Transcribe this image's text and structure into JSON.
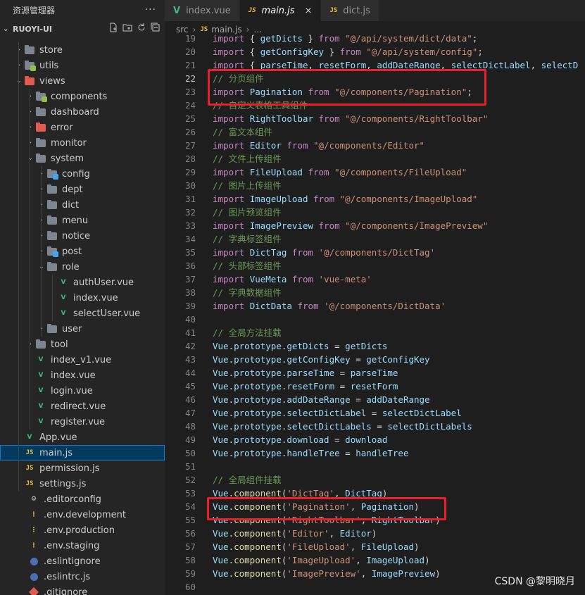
{
  "explorer": {
    "title": "资源管理器",
    "more": "···",
    "root_label": "RUOYI-UI",
    "items": [
      {
        "label": "store",
        "depth": 1,
        "kind": "folder",
        "chev": "›"
      },
      {
        "label": "utils",
        "depth": 1,
        "kind": "folder-green",
        "chev": "›"
      },
      {
        "label": "views",
        "depth": 1,
        "kind": "folder-red",
        "chev": "⌄"
      },
      {
        "label": "components",
        "depth": 2,
        "kind": "folder-green",
        "chev": "›"
      },
      {
        "label": "dashboard",
        "depth": 2,
        "kind": "folder",
        "chev": "›"
      },
      {
        "label": "error",
        "depth": 2,
        "kind": "folder-red",
        "chev": "›"
      },
      {
        "label": "monitor",
        "depth": 2,
        "kind": "folder",
        "chev": "›"
      },
      {
        "label": "system",
        "depth": 2,
        "kind": "folder",
        "chev": "⌄"
      },
      {
        "label": "config",
        "depth": 3,
        "kind": "folder-blue",
        "chev": "›"
      },
      {
        "label": "dept",
        "depth": 3,
        "kind": "folder",
        "chev": "›"
      },
      {
        "label": "dict",
        "depth": 3,
        "kind": "folder",
        "chev": "›"
      },
      {
        "label": "menu",
        "depth": 3,
        "kind": "folder",
        "chev": "›"
      },
      {
        "label": "notice",
        "depth": 3,
        "kind": "folder",
        "chev": "›"
      },
      {
        "label": "post",
        "depth": 3,
        "kind": "folder-blue",
        "chev": "›"
      },
      {
        "label": "role",
        "depth": 3,
        "kind": "folder",
        "chev": "⌄"
      },
      {
        "label": "authUser.vue",
        "depth": 4,
        "kind": "vue",
        "chev": ""
      },
      {
        "label": "index.vue",
        "depth": 4,
        "kind": "vue",
        "chev": ""
      },
      {
        "label": "selectUser.vue",
        "depth": 4,
        "kind": "vue",
        "chev": ""
      },
      {
        "label": "user",
        "depth": 3,
        "kind": "folder",
        "chev": "›"
      },
      {
        "label": "tool",
        "depth": 2,
        "kind": "folder",
        "chev": "›"
      },
      {
        "label": "index_v1.vue",
        "depth": 2,
        "kind": "vue",
        "chev": ""
      },
      {
        "label": "index.vue",
        "depth": 2,
        "kind": "vue",
        "chev": ""
      },
      {
        "label": "login.vue",
        "depth": 2,
        "kind": "vue",
        "chev": ""
      },
      {
        "label": "redirect.vue",
        "depth": 2,
        "kind": "vue",
        "chev": ""
      },
      {
        "label": "register.vue",
        "depth": 2,
        "kind": "vue",
        "chev": ""
      },
      {
        "label": "App.vue",
        "depth": 1,
        "kind": "vue",
        "chev": ""
      },
      {
        "label": "main.js",
        "depth": 1,
        "kind": "js",
        "chev": "",
        "selected": true
      },
      {
        "label": "permission.js",
        "depth": 1,
        "kind": "js",
        "chev": ""
      },
      {
        "label": "settings.js",
        "depth": 1,
        "kind": "js",
        "chev": ""
      },
      {
        "label": ".editorconfig",
        "depth": 0,
        "kind": "gear",
        "chev": ""
      },
      {
        "label": ".env.development",
        "depth": 0,
        "kind": "env",
        "chev": ""
      },
      {
        "label": ".env.production",
        "depth": 0,
        "kind": "env",
        "chev": ""
      },
      {
        "label": ".env.staging",
        "depth": 0,
        "kind": "env",
        "chev": ""
      },
      {
        "label": ".eslintignore",
        "depth": 0,
        "kind": "dot",
        "chev": ""
      },
      {
        "label": ".eslintrc.js",
        "depth": 0,
        "kind": "dot",
        "chev": ""
      },
      {
        "label": ".gitignore",
        "depth": 0,
        "kind": "git",
        "chev": ""
      }
    ]
  },
  "tabs": [
    {
      "label": "index.vue",
      "icon": "vue",
      "active": false
    },
    {
      "label": "main.js",
      "icon": "js",
      "active": true,
      "close": "×"
    },
    {
      "label": "dict.js",
      "icon": "js",
      "active": false
    }
  ],
  "breadcrumb": [
    "src",
    "main.js",
    "..."
  ],
  "breadcrumb_sep": "›",
  "icons": {
    "vue": "V",
    "js": "JS"
  },
  "current_line": 22,
  "code_lines": [
    {
      "n": 19,
      "t": [
        [
          "kw",
          "import"
        ],
        [
          "pl",
          " { "
        ],
        [
          "id",
          "getDicts"
        ],
        [
          "pl",
          " } "
        ],
        [
          "kw",
          "from"
        ],
        [
          "str",
          " \"@/api/system/dict/data\""
        ],
        [
          "pl",
          ";"
        ]
      ]
    },
    {
      "n": 20,
      "t": [
        [
          "kw",
          "import"
        ],
        [
          "pl",
          " { "
        ],
        [
          "id",
          "getConfigKey"
        ],
        [
          "pl",
          " } "
        ],
        [
          "kw",
          "from"
        ],
        [
          "str",
          " \"@/api/system/config\""
        ],
        [
          "pl",
          ";"
        ]
      ]
    },
    {
      "n": 21,
      "t": [
        [
          "kw",
          "import"
        ],
        [
          "pl",
          " { "
        ],
        [
          "id",
          "parseTime"
        ],
        [
          "pl",
          ", "
        ],
        [
          "id",
          "resetForm"
        ],
        [
          "pl",
          ", "
        ],
        [
          "id",
          "addDateRange"
        ],
        [
          "pl",
          ", "
        ],
        [
          "id",
          "selectDictLabel"
        ],
        [
          "pl",
          ", "
        ],
        [
          "id",
          "selectD"
        ]
      ]
    },
    {
      "n": 22,
      "t": [
        [
          "cm",
          "// 分页组件"
        ]
      ]
    },
    {
      "n": 23,
      "t": [
        [
          "kw",
          "import"
        ],
        [
          "pl",
          " "
        ],
        [
          "id",
          "Pagination"
        ],
        [
          "pl",
          " "
        ],
        [
          "kw",
          "from"
        ],
        [
          "str",
          " \"@/components/Pagination\""
        ],
        [
          "pl",
          ";"
        ]
      ]
    },
    {
      "n": 24,
      "t": [
        [
          "cm",
          "// 自定义表格工具组件"
        ]
      ]
    },
    {
      "n": 25,
      "t": [
        [
          "kw",
          "import"
        ],
        [
          "pl",
          " "
        ],
        [
          "id",
          "RightToolbar"
        ],
        [
          "pl",
          " "
        ],
        [
          "kw",
          "from"
        ],
        [
          "str",
          " \"@/components/RightToolbar\""
        ]
      ]
    },
    {
      "n": 26,
      "t": [
        [
          "cm",
          "// 富文本组件"
        ]
      ]
    },
    {
      "n": 27,
      "t": [
        [
          "kw",
          "import"
        ],
        [
          "pl",
          " "
        ],
        [
          "id",
          "Editor"
        ],
        [
          "pl",
          " "
        ],
        [
          "kw",
          "from"
        ],
        [
          "str",
          " \"@/components/Editor\""
        ]
      ]
    },
    {
      "n": 28,
      "t": [
        [
          "cm",
          "// 文件上传组件"
        ]
      ]
    },
    {
      "n": 29,
      "t": [
        [
          "kw",
          "import"
        ],
        [
          "pl",
          " "
        ],
        [
          "id",
          "FileUpload"
        ],
        [
          "pl",
          " "
        ],
        [
          "kw",
          "from"
        ],
        [
          "str",
          " \"@/components/FileUpload\""
        ]
      ]
    },
    {
      "n": 30,
      "t": [
        [
          "cm",
          "// 图片上传组件"
        ]
      ]
    },
    {
      "n": 31,
      "t": [
        [
          "kw",
          "import"
        ],
        [
          "pl",
          " "
        ],
        [
          "id",
          "ImageUpload"
        ],
        [
          "pl",
          " "
        ],
        [
          "kw",
          "from"
        ],
        [
          "str",
          " \"@/components/ImageUpload\""
        ]
      ]
    },
    {
      "n": 32,
      "t": [
        [
          "cm",
          "// 图片预览组件"
        ]
      ]
    },
    {
      "n": 33,
      "t": [
        [
          "kw",
          "import"
        ],
        [
          "pl",
          " "
        ],
        [
          "id",
          "ImagePreview"
        ],
        [
          "pl",
          " "
        ],
        [
          "kw",
          "from"
        ],
        [
          "str",
          " \"@/components/ImagePreview\""
        ]
      ]
    },
    {
      "n": 34,
      "t": [
        [
          "cm",
          "// 字典标签组件"
        ]
      ]
    },
    {
      "n": 35,
      "t": [
        [
          "kw",
          "import"
        ],
        [
          "pl",
          " "
        ],
        [
          "id",
          "DictTag"
        ],
        [
          "pl",
          " "
        ],
        [
          "kw",
          "from"
        ],
        [
          "str",
          " '@/components/DictTag'"
        ]
      ]
    },
    {
      "n": 36,
      "t": [
        [
          "cm",
          "// 头部标签组件"
        ]
      ]
    },
    {
      "n": 37,
      "t": [
        [
          "kw",
          "import"
        ],
        [
          "pl",
          " "
        ],
        [
          "id",
          "VueMeta"
        ],
        [
          "pl",
          " "
        ],
        [
          "kw",
          "from"
        ],
        [
          "str",
          " 'vue-meta'"
        ]
      ]
    },
    {
      "n": 38,
      "t": [
        [
          "cm",
          "// 字典数据组件"
        ]
      ]
    },
    {
      "n": 39,
      "t": [
        [
          "kw",
          "import"
        ],
        [
          "pl",
          " "
        ],
        [
          "id",
          "DictData"
        ],
        [
          "pl",
          " "
        ],
        [
          "kw",
          "from"
        ],
        [
          "str",
          " '@/components/DictData'"
        ]
      ]
    },
    {
      "n": 40,
      "t": []
    },
    {
      "n": 41,
      "t": [
        [
          "cm",
          "// 全局方法挂载"
        ]
      ]
    },
    {
      "n": 42,
      "t": [
        [
          "id",
          "Vue"
        ],
        [
          "pl",
          "."
        ],
        [
          "id",
          "prototype"
        ],
        [
          "pl",
          "."
        ],
        [
          "id",
          "getDicts"
        ],
        [
          "pl",
          " = "
        ],
        [
          "id",
          "getDicts"
        ]
      ]
    },
    {
      "n": 43,
      "t": [
        [
          "id",
          "Vue"
        ],
        [
          "pl",
          "."
        ],
        [
          "id",
          "prototype"
        ],
        [
          "pl",
          "."
        ],
        [
          "id",
          "getConfigKey"
        ],
        [
          "pl",
          " = "
        ],
        [
          "id",
          "getConfigKey"
        ]
      ]
    },
    {
      "n": 44,
      "t": [
        [
          "id",
          "Vue"
        ],
        [
          "pl",
          "."
        ],
        [
          "id",
          "prototype"
        ],
        [
          "pl",
          "."
        ],
        [
          "id",
          "parseTime"
        ],
        [
          "pl",
          " = "
        ],
        [
          "id",
          "parseTime"
        ]
      ]
    },
    {
      "n": 45,
      "t": [
        [
          "id",
          "Vue"
        ],
        [
          "pl",
          "."
        ],
        [
          "id",
          "prototype"
        ],
        [
          "pl",
          "."
        ],
        [
          "id",
          "resetForm"
        ],
        [
          "pl",
          " = "
        ],
        [
          "id",
          "resetForm"
        ]
      ]
    },
    {
      "n": 46,
      "t": [
        [
          "id",
          "Vue"
        ],
        [
          "pl",
          "."
        ],
        [
          "id",
          "prototype"
        ],
        [
          "pl",
          "."
        ],
        [
          "id",
          "addDateRange"
        ],
        [
          "pl",
          " = "
        ],
        [
          "id",
          "addDateRange"
        ]
      ]
    },
    {
      "n": 47,
      "t": [
        [
          "id",
          "Vue"
        ],
        [
          "pl",
          "."
        ],
        [
          "id",
          "prototype"
        ],
        [
          "pl",
          "."
        ],
        [
          "id",
          "selectDictLabel"
        ],
        [
          "pl",
          " = "
        ],
        [
          "id",
          "selectDictLabel"
        ]
      ]
    },
    {
      "n": 48,
      "t": [
        [
          "id",
          "Vue"
        ],
        [
          "pl",
          "."
        ],
        [
          "id",
          "prototype"
        ],
        [
          "pl",
          "."
        ],
        [
          "id",
          "selectDictLabels"
        ],
        [
          "pl",
          " = "
        ],
        [
          "id",
          "selectDictLabels"
        ]
      ]
    },
    {
      "n": 49,
      "t": [
        [
          "id",
          "Vue"
        ],
        [
          "pl",
          "."
        ],
        [
          "id",
          "prototype"
        ],
        [
          "pl",
          "."
        ],
        [
          "id",
          "download"
        ],
        [
          "pl",
          " = "
        ],
        [
          "id",
          "download"
        ]
      ]
    },
    {
      "n": 50,
      "t": [
        [
          "id",
          "Vue"
        ],
        [
          "pl",
          "."
        ],
        [
          "id",
          "prototype"
        ],
        [
          "pl",
          "."
        ],
        [
          "id",
          "handleTree"
        ],
        [
          "pl",
          " = "
        ],
        [
          "id",
          "handleTree"
        ]
      ]
    },
    {
      "n": 51,
      "t": []
    },
    {
      "n": 52,
      "t": [
        [
          "cm",
          "// 全局组件挂载"
        ]
      ]
    },
    {
      "n": 53,
      "t": [
        [
          "id",
          "Vue"
        ],
        [
          "pl",
          "."
        ],
        [
          "fn",
          "component"
        ],
        [
          "pl",
          "("
        ],
        [
          "str",
          "'DictTag'"
        ],
        [
          "pl",
          ", "
        ],
        [
          "id",
          "DictTag"
        ],
        [
          "pl",
          ")"
        ]
      ]
    },
    {
      "n": 54,
      "t": [
        [
          "id",
          "Vue"
        ],
        [
          "pl",
          "."
        ],
        [
          "fn",
          "component"
        ],
        [
          "pl",
          "("
        ],
        [
          "str",
          "'Pagination'"
        ],
        [
          "pl",
          ", "
        ],
        [
          "id",
          "Pagination"
        ],
        [
          "pl",
          ")"
        ]
      ]
    },
    {
      "n": 55,
      "t": [
        [
          "id",
          "Vue"
        ],
        [
          "pl",
          "."
        ],
        [
          "fn",
          "component"
        ],
        [
          "pl",
          "("
        ],
        [
          "str",
          "'RightToolbar'"
        ],
        [
          "pl",
          ", "
        ],
        [
          "id",
          "RightToolbar"
        ],
        [
          "pl",
          ")"
        ]
      ]
    },
    {
      "n": 56,
      "t": [
        [
          "id",
          "Vue"
        ],
        [
          "pl",
          "."
        ],
        [
          "fn",
          "component"
        ],
        [
          "pl",
          "("
        ],
        [
          "str",
          "'Editor'"
        ],
        [
          "pl",
          ", "
        ],
        [
          "id",
          "Editor"
        ],
        [
          "pl",
          ")"
        ]
      ]
    },
    {
      "n": 57,
      "t": [
        [
          "id",
          "Vue"
        ],
        [
          "pl",
          "."
        ],
        [
          "fn",
          "component"
        ],
        [
          "pl",
          "("
        ],
        [
          "str",
          "'FileUpload'"
        ],
        [
          "pl",
          ", "
        ],
        [
          "id",
          "FileUpload"
        ],
        [
          "pl",
          ")"
        ]
      ]
    },
    {
      "n": 58,
      "t": [
        [
          "id",
          "Vue"
        ],
        [
          "pl",
          "."
        ],
        [
          "fn",
          "component"
        ],
        [
          "pl",
          "("
        ],
        [
          "str",
          "'ImageUpload'"
        ],
        [
          "pl",
          ", "
        ],
        [
          "id",
          "ImageUpload"
        ],
        [
          "pl",
          ")"
        ]
      ]
    },
    {
      "n": 59,
      "t": [
        [
          "id",
          "Vue"
        ],
        [
          "pl",
          "."
        ],
        [
          "fn",
          "component"
        ],
        [
          "pl",
          "("
        ],
        [
          "str",
          "'ImagePreview'"
        ],
        [
          "pl",
          ", "
        ],
        [
          "id",
          "ImagePreview"
        ],
        [
          "pl",
          ")"
        ]
      ]
    },
    {
      "n": 60,
      "t": []
    }
  ],
  "highlight_boxes": [
    {
      "first_line": 22,
      "last_line": 23,
      "label": "pagination-import-highlight"
    },
    {
      "first_line": 54,
      "last_line": 54,
      "label": "pagination-register-highlight"
    }
  ],
  "watermark": "CSDN @黎明晓月"
}
